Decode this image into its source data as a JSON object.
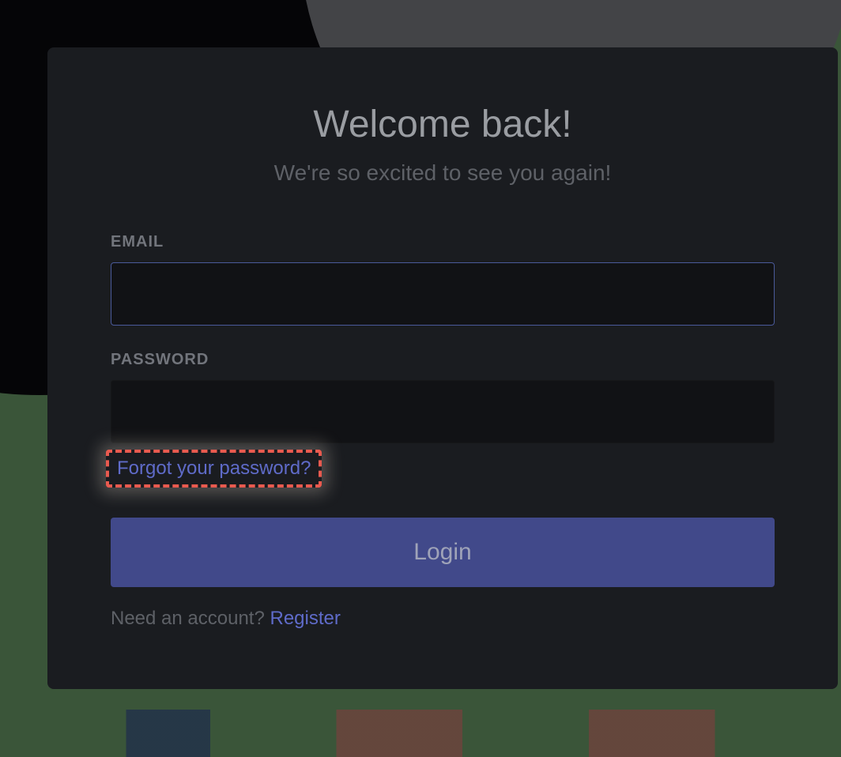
{
  "heading": "Welcome back!",
  "subheading": "We're so excited to see you again!",
  "email": {
    "label": "EMAIL",
    "value": ""
  },
  "password": {
    "label": "PASSWORD",
    "value": ""
  },
  "forgot_password_text": "Forgot your password?",
  "login_button_label": "Login",
  "register": {
    "prompt": "Need an account? ",
    "link_text": "Register"
  },
  "colors": {
    "card_bg": "#1a1c20",
    "accent_link": "#5f6bc9",
    "button_bg": "#41498a",
    "highlight_border": "#e85a4f"
  }
}
